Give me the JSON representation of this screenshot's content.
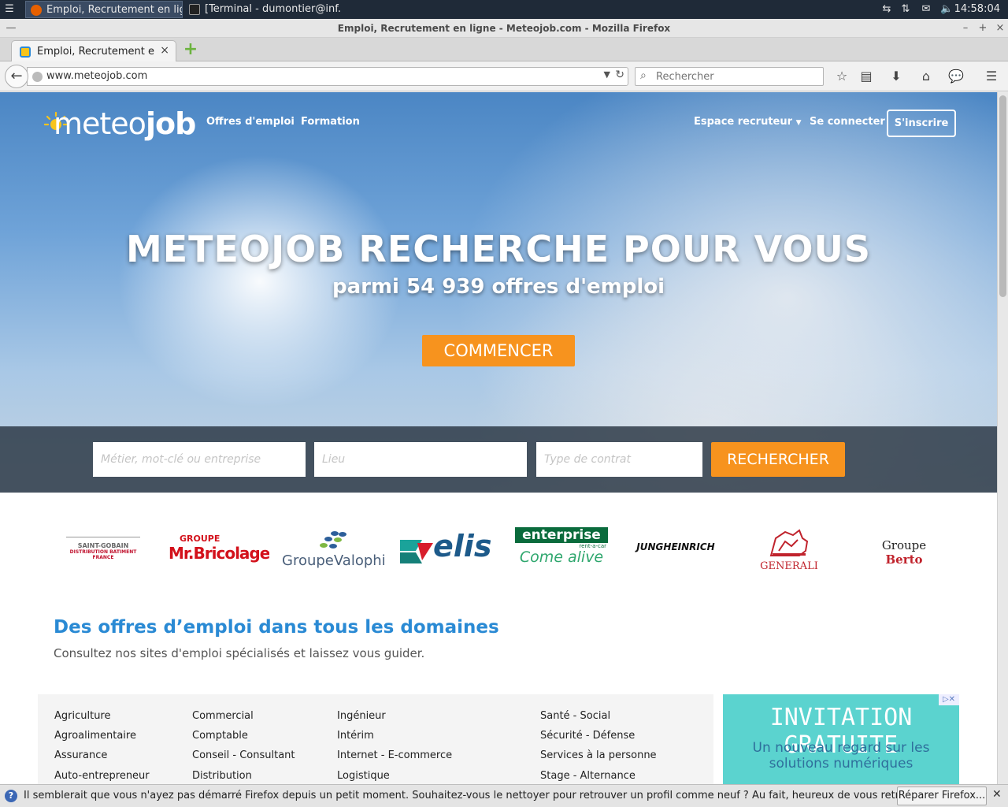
{
  "taskbar": {
    "tasks": [
      {
        "label": "Emploi, Recrutement en lig..."
      },
      {
        "label": "[Terminal - dumontier@inf..."
      }
    ],
    "clock": "14:58:04"
  },
  "window": {
    "title": "Emploi, Recrutement en ligne - Meteojob.com - Mozilla Firefox"
  },
  "browser": {
    "tab_title": "Emploi, Recrutement e...",
    "url": "www.meteojob.com",
    "search_placeholder": "Rechercher"
  },
  "site": {
    "logo_text_light": "meteo",
    "logo_text_bold": "job",
    "nav": {
      "offres": "Offres d'emploi",
      "formation": "Formation",
      "recruteur": "Espace recruteur",
      "connecter": "Se connecter",
      "inscrire": "S'inscrire"
    },
    "hero": {
      "title": "METEOJOB RECHERCHE POUR VOUS",
      "subtitle": "parmi 54 939 offres d'emploi",
      "cta": "COMMENCER"
    },
    "search": {
      "metier_placeholder": "Métier, mot-clé ou entreprise",
      "lieu_placeholder": "Lieu",
      "contrat_placeholder": "Type de contrat",
      "button": "RECHERCHER"
    },
    "brands": {
      "saint_gobain": [
        "SAINT-GOBAIN",
        "DISTRIBUTION BATIMENT",
        "FRANCE"
      ],
      "bricolage": [
        "GROUPE",
        "Mr.Bricolage"
      ],
      "valophis": "GroupeValophis",
      "elis": "elis",
      "enterprise": [
        "enterprise",
        "rent-a-car",
        "Come alive"
      ],
      "jungheinrich": "JUNGHEINRICH",
      "generali": "GENERALI",
      "berto": [
        "Groupe",
        "Berto"
      ]
    },
    "domains": {
      "title": "Des offres d’emploi dans tous les domaines",
      "subtitle": "Consultez nos sites d'emploi spécialisés et laissez vous guider.",
      "columns": [
        [
          "Agriculture",
          "Agroalimentaire",
          "Assurance",
          "Auto-entrepreneur"
        ],
        [
          "Commercial",
          "Comptable",
          "Conseil - Consultant",
          "Distribution"
        ],
        [
          "Ingénieur",
          "Intérim",
          "Internet - E-commerce",
          "Logistique"
        ],
        [
          "Santé - Social",
          "Sécurité - Défense",
          "Services à la personne",
          "Stage - Alternance"
        ]
      ]
    },
    "ad": {
      "headline": "INVITATION GRATUITE",
      "body_line1": "Un nouveau regard sur les",
      "body_line2": "solutions numériques"
    }
  },
  "notification": {
    "message": "Il semblerait que vous n'ayez pas démarré Firefox depuis un petit moment. Souhaitez-vous le nettoyer pour retrouver un profil comme neuf ? Au fait, heureux de vous retrouver !",
    "button": "Réparer Firefox..."
  },
  "colors": {
    "accent_orange": "#f7931e",
    "link_blue": "#2a8ad4",
    "ad_teal": "#5bd3cf"
  }
}
